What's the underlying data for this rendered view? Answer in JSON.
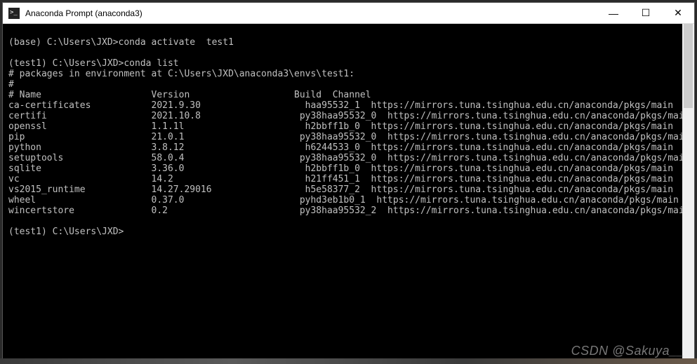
{
  "window": {
    "title": "Anaconda Prompt (anaconda3)"
  },
  "lines": {
    "l0": "(base) C:\\Users\\JXD>conda activate  test1",
    "l1": "",
    "l2": "(test1) C:\\Users\\JXD>conda list",
    "l3": "# packages in environment at C:\\Users\\JXD\\anaconda3\\envs\\test1:",
    "l4": "#",
    "l5": "# Name                    Version                   Build  Channel",
    "prompt": "(test1) C:\\Users\\JXD>"
  },
  "packages": [
    {
      "name": "ca-certificates",
      "version": "2021.9.30",
      "build": "haa95532_1",
      "channel": "https://mirrors.tuna.tsinghua.edu.cn/anaconda/pkgs/main"
    },
    {
      "name": "certifi",
      "version": "2021.10.8",
      "build": "py38haa95532_0",
      "channel": "https://mirrors.tuna.tsinghua.edu.cn/anaconda/pkgs/main"
    },
    {
      "name": "openssl",
      "version": "1.1.1l",
      "build": "h2bbff1b_0",
      "channel": "https://mirrors.tuna.tsinghua.edu.cn/anaconda/pkgs/main"
    },
    {
      "name": "pip",
      "version": "21.0.1",
      "build": "py38haa95532_0",
      "channel": "https://mirrors.tuna.tsinghua.edu.cn/anaconda/pkgs/main"
    },
    {
      "name": "python",
      "version": "3.8.12",
      "build": "h6244533_0",
      "channel": "https://mirrors.tuna.tsinghua.edu.cn/anaconda/pkgs/main"
    },
    {
      "name": "setuptools",
      "version": "58.0.4",
      "build": "py38haa95532_0",
      "channel": "https://mirrors.tuna.tsinghua.edu.cn/anaconda/pkgs/main"
    },
    {
      "name": "sqlite",
      "version": "3.36.0",
      "build": "h2bbff1b_0",
      "channel": "https://mirrors.tuna.tsinghua.edu.cn/anaconda/pkgs/main"
    },
    {
      "name": "vc",
      "version": "14.2",
      "build": "h21ff451_1",
      "channel": "https://mirrors.tuna.tsinghua.edu.cn/anaconda/pkgs/main"
    },
    {
      "name": "vs2015_runtime",
      "version": "14.27.29016",
      "build": "h5e58377_2",
      "channel": "https://mirrors.tuna.tsinghua.edu.cn/anaconda/pkgs/main"
    },
    {
      "name": "wheel",
      "version": "0.37.0",
      "build": "pyhd3eb1b0_1",
      "channel": "https://mirrors.tuna.tsinghua.edu.cn/anaconda/pkgs/main"
    },
    {
      "name": "wincertstore",
      "version": "0.2",
      "build": "py38haa95532_2",
      "channel": "https://mirrors.tuna.tsinghua.edu.cn/anaconda/pkgs/main"
    }
  ],
  "cols": {
    "name": 0,
    "version": 26,
    "build": 53,
    "channel": 66
  },
  "watermark": "CSDN @Sakuya__"
}
